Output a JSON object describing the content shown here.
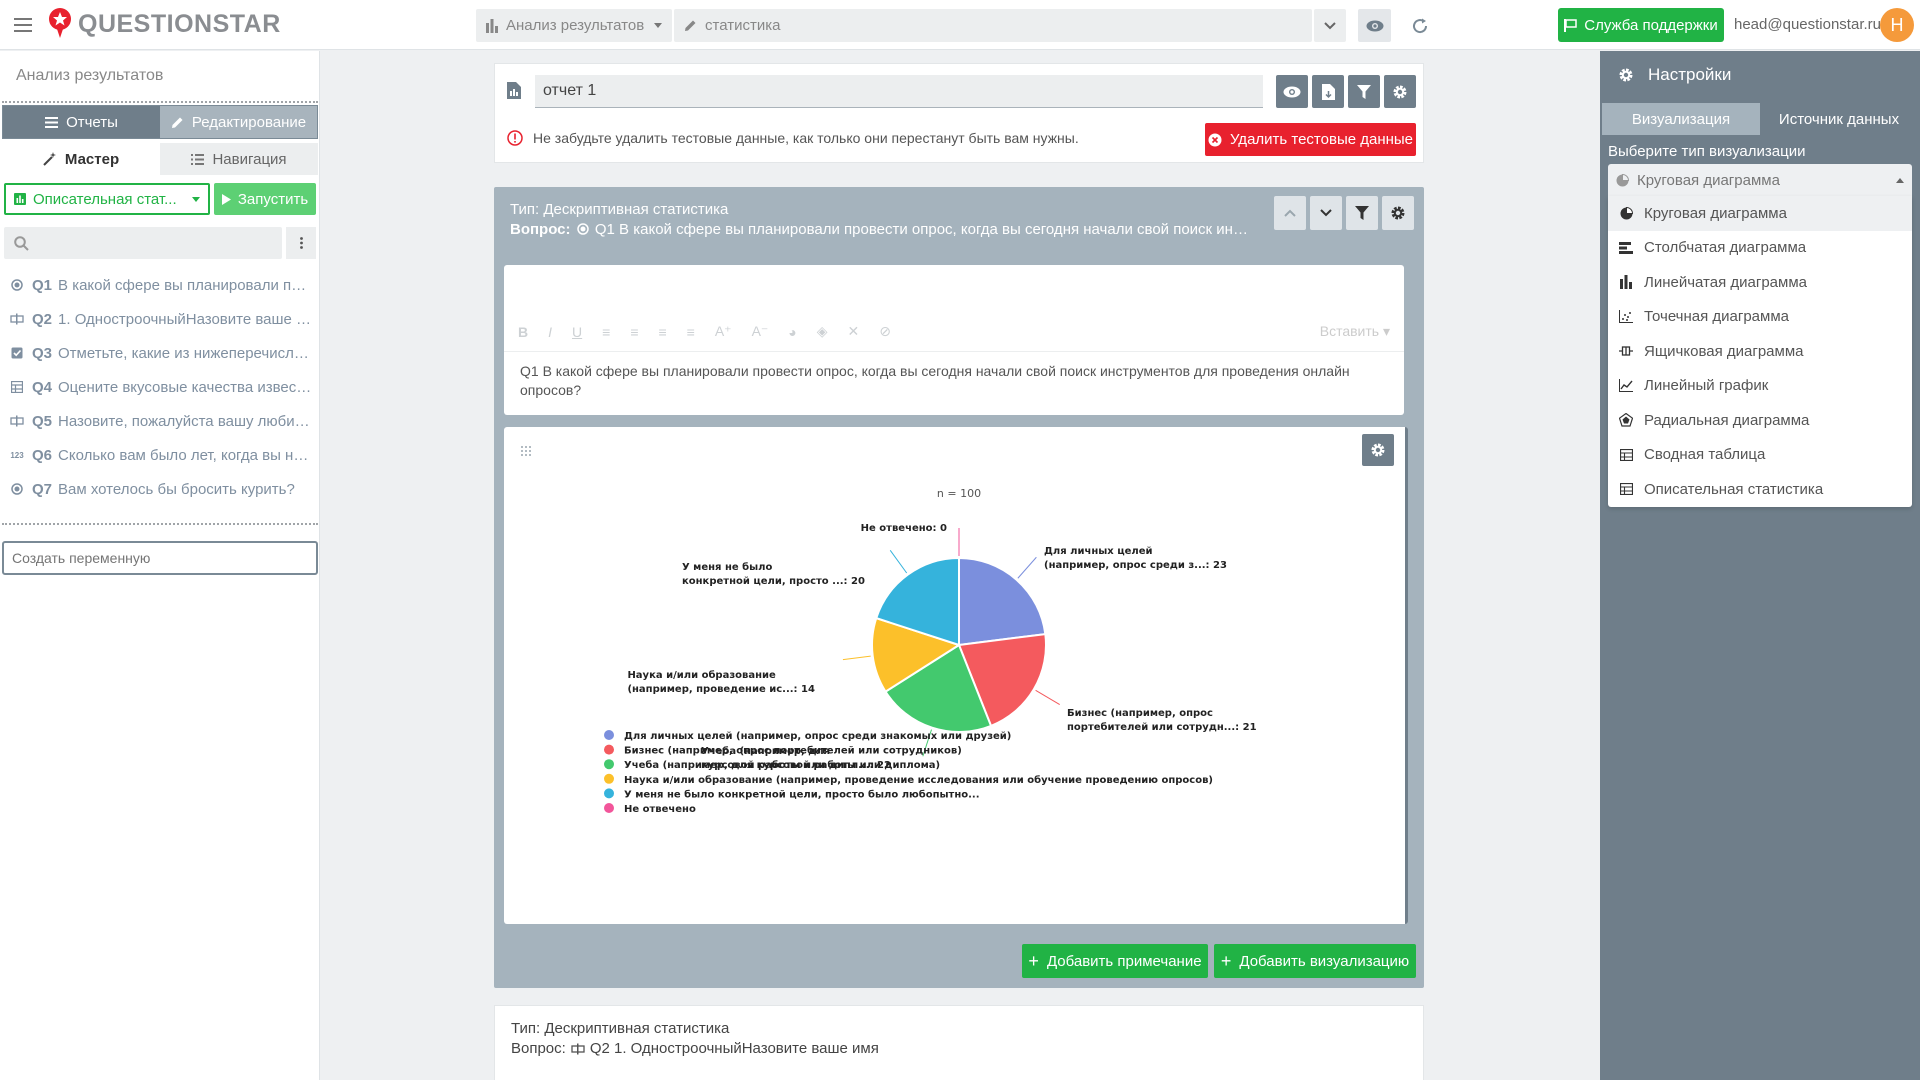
{
  "topbar": {
    "logo_text": "QUESTIONSTAR",
    "section_select": "Анализ результатов",
    "section_input": "статистика",
    "support_label": "Служба поддержки",
    "user_email": "head@questionstar.ru",
    "avatar_letter": "H"
  },
  "sidebar": {
    "title": "Анализ результатов",
    "seg_reports": "Отчеты",
    "seg_edit": "Редактирование",
    "tab_master": "Мастер",
    "tab_nav": "Навигация",
    "run_select": "Описательная стат...",
    "run_label": "Запустить",
    "search_placeholder": "",
    "questions": [
      {
        "icon": "radio",
        "num": "Q1",
        "text": "В какой сфере вы планировали пров..."
      },
      {
        "icon": "text-input",
        "num": "Q2",
        "text": "1. ОдностроочныйНазовите ваше имя"
      },
      {
        "icon": "checkbox",
        "num": "Q3",
        "text": "Отметьте, какие из нижеперечисленн..."
      },
      {
        "icon": "grid",
        "num": "Q4",
        "text": "Оцените вкусовые качества известн..."
      },
      {
        "icon": "text-input",
        "num": "Q5",
        "text": "Назовите, пожалуйста вашу любиму..."
      },
      {
        "icon": "number",
        "num": "Q6",
        "text": "Сколько вам было лет, когда вы нач..."
      },
      {
        "icon": "radio",
        "num": "Q7",
        "text": "Вам хотелось бы бросить курить?"
      }
    ],
    "create_var_placeholder": "Создать переменную"
  },
  "report": {
    "name": "отчет 1",
    "warning": "Не забудьте удалить тестовые данные, как только они перестанут быть вам нужны.",
    "delete_label": "Удалить тестовые данные"
  },
  "block1": {
    "type_line": "Тип: Дескриптивная статистика",
    "question_prefix": "Вопрос:",
    "question_text": "Q1 В какой сфере вы планировали провести опрос, когда вы сегодня начали свой поиск инструмен...",
    "editor_insert": "Вставить",
    "editor_text": "Q1 В какой сфере вы планировали провести опрос, когда вы сегодня начали свой поиск инструментов для проведения онлайн опросов?",
    "add_note": "Добавить примечание",
    "add_vis": "Добавить визуализацию"
  },
  "block2": {
    "type_line": "Тип: Дескриптивная статистика",
    "question_prefix": "Вопрос:",
    "question_text": "Q2 1. ОдностроочныйНазовите ваше имя"
  },
  "chart_data": {
    "type": "pie",
    "title": "n = 100",
    "categories": [
      "Для личных целей (например, опрос среди знакомых или друзей)",
      "Бизнес (например, опрос портебителей или сотрудников)",
      "Учеба (например, для курсовой работы или диплома)",
      "Наука и/или образование (например, проведение исследования или обучение проведению опросов)",
      "У меня не было конкретной цели, просто было любопытно...",
      "Не отвечено"
    ],
    "values": [
      23,
      21,
      22,
      14,
      20,
      0
    ],
    "slice_labels": [
      [
        "Для личных целей",
        "(например, опрос среди з...: 23"
      ],
      [
        "Бизнес (например, опрос",
        "портебителей или сотрудн...: 21"
      ],
      [
        "Учеба (например, для",
        "курсовой работы или дипл...: 22"
      ],
      [
        "Наука и/или образование",
        "(например, проведение ис...: 14"
      ],
      [
        "У меня не было",
        "конкретной цели, просто ...: 20"
      ],
      [
        "Не отвечено: 0"
      ]
    ],
    "colors": [
      "#7b8fdd",
      "#f45a5e",
      "#43c96e",
      "#fcc02a",
      "#35b3dc",
      "#f2559a"
    ],
    "legend_position": "bottom-left"
  },
  "rpanel": {
    "title": "Настройки",
    "tab_vis": "Визуализация",
    "tab_source": "Источник данных",
    "select_label": "Выберите тип визуализации",
    "selected": "Круговая диаграмма",
    "options": [
      {
        "icon": "pie",
        "label": "Круговая диаграмма"
      },
      {
        "icon": "hbar",
        "label": "Столбчатая диаграмма"
      },
      {
        "icon": "vbar",
        "label": "Линейчатая диаграмма"
      },
      {
        "icon": "scatter",
        "label": "Точечная диаграмма"
      },
      {
        "icon": "box",
        "label": "Ящичковая диаграмма"
      },
      {
        "icon": "line",
        "label": "Линейный график"
      },
      {
        "icon": "radar",
        "label": "Радиальная диаграмма"
      },
      {
        "icon": "table",
        "label": "Сводная таблица"
      },
      {
        "icon": "table",
        "label": "Описательная статистика"
      }
    ]
  }
}
